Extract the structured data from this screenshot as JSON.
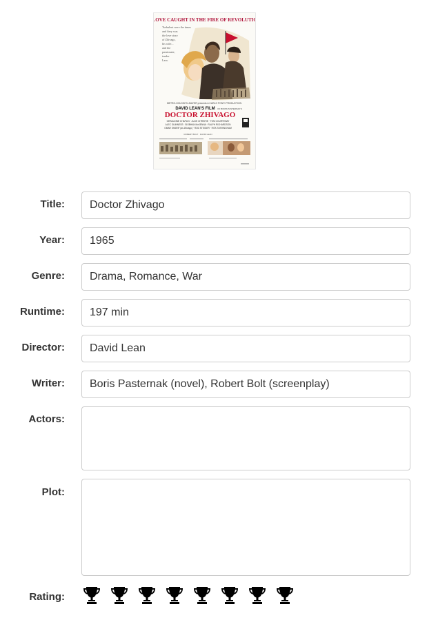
{
  "poster": {
    "tagline": "A LOVE CAUGHT IN THE FIRE OF REVOLUTION",
    "blurb": [
      "Turbulent were the times",
      "and fiery was",
      "the love story",
      "of Zhivago,",
      "his wife...",
      "and the",
      "passionate,",
      "tender",
      "Lara."
    ],
    "studio_line": "METRO-GOLDWYN-MAYER presents A CARLO PONTI PRODUCTION",
    "film_line": "DAVID LEAN'S FILM",
    "film_of": "OF BORIS PASTERNAK'S",
    "title": "DOCTOR ZHIVAGO",
    "cast_lines": [
      "GERALDINE CHAPLIN · JULIE CHRISTIE · TOM COURTENAY",
      "ALEC GUINNESS · SIOBHAN McKENNA · RALPH RICHARDSON",
      "OMAR SHARIF (as Zhivago) · ROD STEIGER · RITA TUSHINGHAM"
    ],
    "credits_line": "ROBERT BOLT · DAVID LEAN",
    "colors": {
      "tagline": "#b0143c",
      "title": "#c8102e"
    }
  },
  "form": {
    "title": {
      "label": "Title:",
      "value": "Doctor Zhivago"
    },
    "year": {
      "label": "Year:",
      "value": "1965"
    },
    "genre": {
      "label": "Genre:",
      "value": "Drama, Romance, War"
    },
    "runtime": {
      "label": "Runtime:",
      "value": "197 min"
    },
    "director": {
      "label": "Director:",
      "value": "David Lean"
    },
    "writer": {
      "label": "Writer:",
      "value": "Boris Pasternak (novel), Robert Bolt (screenplay)"
    },
    "actors": {
      "label": "Actors:",
      "value": ""
    },
    "plot": {
      "label": "Plot:",
      "value": ""
    },
    "rating": {
      "label": "Rating:",
      "value": 8,
      "max": 8,
      "icon": "trophy-icon"
    }
  },
  "colors": {
    "label": "#333333",
    "input_border": "#cccccc",
    "text": "#333333",
    "trophy": "#000000"
  }
}
